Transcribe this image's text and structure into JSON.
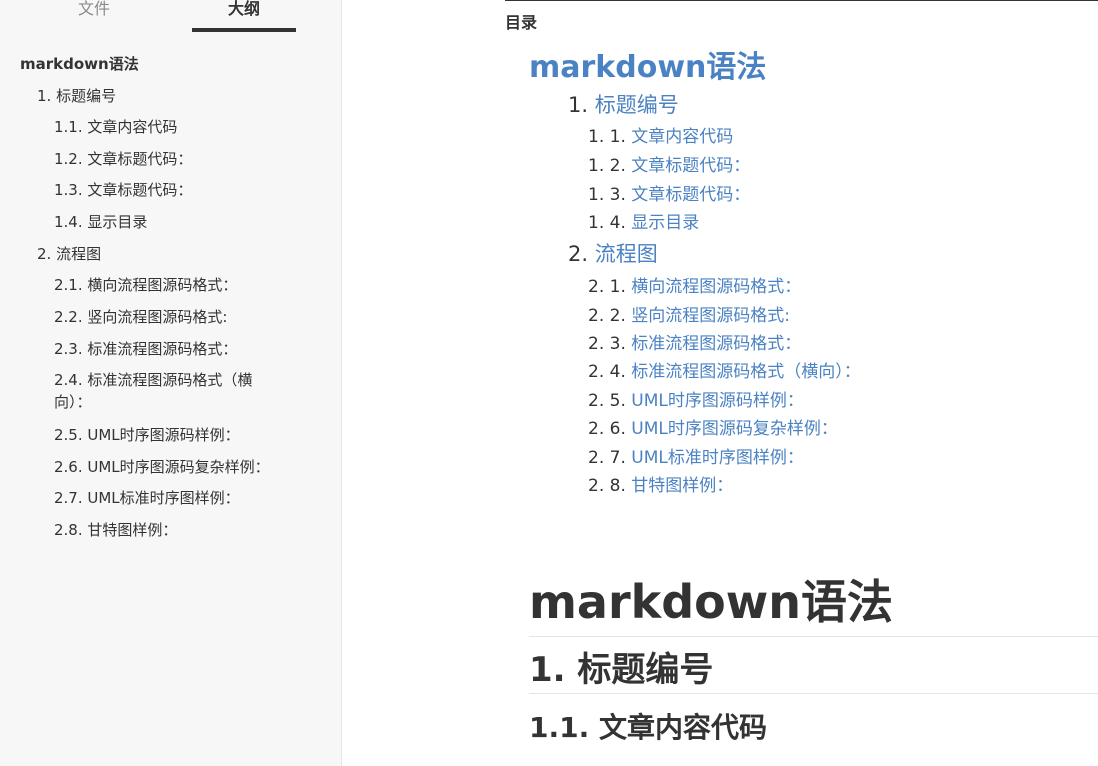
{
  "sidebar": {
    "tabs": [
      "文件",
      "大纲"
    ],
    "active_tab": "大纲",
    "outline": [
      {
        "level": 1,
        "text": "markdown语法"
      },
      {
        "level": 2,
        "text": "1. 标题编号"
      },
      {
        "level": 3,
        "text": "1.1. 文章内容代码"
      },
      {
        "level": 3,
        "text": "1.2. 文章标题代码："
      },
      {
        "level": 3,
        "text": "1.3. 文章标题代码："
      },
      {
        "level": 3,
        "text": "1.4. 显示目录"
      },
      {
        "level": 2,
        "text": "2. 流程图"
      },
      {
        "level": 3,
        "text": "2.1. 横向流程图源码格式："
      },
      {
        "level": 3,
        "text": "2.2. 竖向流程图源码格式:"
      },
      {
        "level": 3,
        "text": "2.3. 标准流程图源码格式："
      },
      {
        "level": 3,
        "text": "2.4. 标准流程图源码格式（横向）："
      },
      {
        "level": 3,
        "text": "2.5. UML时序图源码样例："
      },
      {
        "level": 3,
        "text": "2.6. UML时序图源码复杂样例："
      },
      {
        "level": 3,
        "text": "2.7. UML标准时序图样例："
      },
      {
        "level": 3,
        "text": "2.8. 甘特图样例："
      }
    ]
  },
  "main": {
    "toc_label": "目录",
    "toc_title": "markdown语法",
    "toc": [
      {
        "level": 2,
        "num": "1.",
        "text": "标题编号"
      },
      {
        "level": 3,
        "num": "1. 1.",
        "text": "文章内容代码"
      },
      {
        "level": 3,
        "num": "1. 2.",
        "text": "文章标题代码："
      },
      {
        "level": 3,
        "num": "1. 3.",
        "text": "文章标题代码："
      },
      {
        "level": 3,
        "num": "1. 4.",
        "text": "显示目录"
      },
      {
        "level": 2,
        "num": "2.",
        "text": "流程图"
      },
      {
        "level": 3,
        "num": "2. 1.",
        "text": "横向流程图源码格式："
      },
      {
        "level": 3,
        "num": "2. 2.",
        "text": "竖向流程图源码格式:"
      },
      {
        "level": 3,
        "num": "2. 3.",
        "text": "标准流程图源码格式："
      },
      {
        "level": 3,
        "num": "2. 4.",
        "text": "标准流程图源码格式（横向）："
      },
      {
        "level": 3,
        "num": "2. 5.",
        "text": "UML时序图源码样例："
      },
      {
        "level": 3,
        "num": "2. 6.",
        "text": "UML时序图源码复杂样例："
      },
      {
        "level": 3,
        "num": "2. 7.",
        "text": "UML标准时序图样例："
      },
      {
        "level": 3,
        "num": "2. 8.",
        "text": "甘特图样例："
      }
    ],
    "h1": "markdown语法",
    "h2": "1. 标题编号",
    "h3": "1.1. 文章内容代码"
  },
  "colors": {
    "link": "#4a82c3",
    "text": "#333333",
    "sidebar_bg": "#f7f7f7"
  }
}
